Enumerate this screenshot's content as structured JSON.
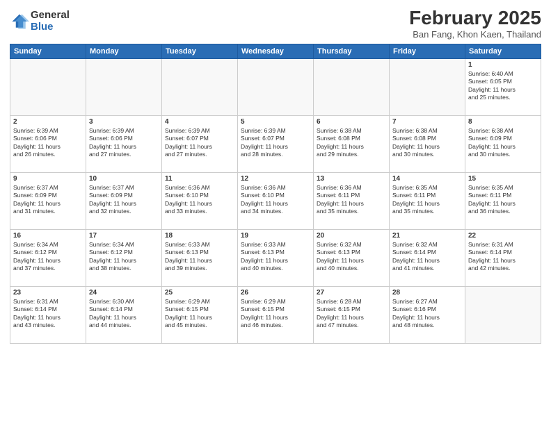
{
  "logo": {
    "general": "General",
    "blue": "Blue"
  },
  "title": "February 2025",
  "subtitle": "Ban Fang, Khon Kaen, Thailand",
  "weekdays": [
    "Sunday",
    "Monday",
    "Tuesday",
    "Wednesday",
    "Thursday",
    "Friday",
    "Saturday"
  ],
  "weeks": [
    [
      {
        "day": "",
        "info": ""
      },
      {
        "day": "",
        "info": ""
      },
      {
        "day": "",
        "info": ""
      },
      {
        "day": "",
        "info": ""
      },
      {
        "day": "",
        "info": ""
      },
      {
        "day": "",
        "info": ""
      },
      {
        "day": "1",
        "info": "Sunrise: 6:40 AM\nSunset: 6:05 PM\nDaylight: 11 hours\nand 25 minutes."
      }
    ],
    [
      {
        "day": "2",
        "info": "Sunrise: 6:39 AM\nSunset: 6:06 PM\nDaylight: 11 hours\nand 26 minutes."
      },
      {
        "day": "3",
        "info": "Sunrise: 6:39 AM\nSunset: 6:06 PM\nDaylight: 11 hours\nand 27 minutes."
      },
      {
        "day": "4",
        "info": "Sunrise: 6:39 AM\nSunset: 6:07 PM\nDaylight: 11 hours\nand 27 minutes."
      },
      {
        "day": "5",
        "info": "Sunrise: 6:39 AM\nSunset: 6:07 PM\nDaylight: 11 hours\nand 28 minutes."
      },
      {
        "day": "6",
        "info": "Sunrise: 6:38 AM\nSunset: 6:08 PM\nDaylight: 11 hours\nand 29 minutes."
      },
      {
        "day": "7",
        "info": "Sunrise: 6:38 AM\nSunset: 6:08 PM\nDaylight: 11 hours\nand 30 minutes."
      },
      {
        "day": "8",
        "info": "Sunrise: 6:38 AM\nSunset: 6:09 PM\nDaylight: 11 hours\nand 30 minutes."
      }
    ],
    [
      {
        "day": "9",
        "info": "Sunrise: 6:37 AM\nSunset: 6:09 PM\nDaylight: 11 hours\nand 31 minutes."
      },
      {
        "day": "10",
        "info": "Sunrise: 6:37 AM\nSunset: 6:09 PM\nDaylight: 11 hours\nand 32 minutes."
      },
      {
        "day": "11",
        "info": "Sunrise: 6:36 AM\nSunset: 6:10 PM\nDaylight: 11 hours\nand 33 minutes."
      },
      {
        "day": "12",
        "info": "Sunrise: 6:36 AM\nSunset: 6:10 PM\nDaylight: 11 hours\nand 34 minutes."
      },
      {
        "day": "13",
        "info": "Sunrise: 6:36 AM\nSunset: 6:11 PM\nDaylight: 11 hours\nand 35 minutes."
      },
      {
        "day": "14",
        "info": "Sunrise: 6:35 AM\nSunset: 6:11 PM\nDaylight: 11 hours\nand 35 minutes."
      },
      {
        "day": "15",
        "info": "Sunrise: 6:35 AM\nSunset: 6:11 PM\nDaylight: 11 hours\nand 36 minutes."
      }
    ],
    [
      {
        "day": "16",
        "info": "Sunrise: 6:34 AM\nSunset: 6:12 PM\nDaylight: 11 hours\nand 37 minutes."
      },
      {
        "day": "17",
        "info": "Sunrise: 6:34 AM\nSunset: 6:12 PM\nDaylight: 11 hours\nand 38 minutes."
      },
      {
        "day": "18",
        "info": "Sunrise: 6:33 AM\nSunset: 6:13 PM\nDaylight: 11 hours\nand 39 minutes."
      },
      {
        "day": "19",
        "info": "Sunrise: 6:33 AM\nSunset: 6:13 PM\nDaylight: 11 hours\nand 40 minutes."
      },
      {
        "day": "20",
        "info": "Sunrise: 6:32 AM\nSunset: 6:13 PM\nDaylight: 11 hours\nand 40 minutes."
      },
      {
        "day": "21",
        "info": "Sunrise: 6:32 AM\nSunset: 6:14 PM\nDaylight: 11 hours\nand 41 minutes."
      },
      {
        "day": "22",
        "info": "Sunrise: 6:31 AM\nSunset: 6:14 PM\nDaylight: 11 hours\nand 42 minutes."
      }
    ],
    [
      {
        "day": "23",
        "info": "Sunrise: 6:31 AM\nSunset: 6:14 PM\nDaylight: 11 hours\nand 43 minutes."
      },
      {
        "day": "24",
        "info": "Sunrise: 6:30 AM\nSunset: 6:14 PM\nDaylight: 11 hours\nand 44 minutes."
      },
      {
        "day": "25",
        "info": "Sunrise: 6:29 AM\nSunset: 6:15 PM\nDaylight: 11 hours\nand 45 minutes."
      },
      {
        "day": "26",
        "info": "Sunrise: 6:29 AM\nSunset: 6:15 PM\nDaylight: 11 hours\nand 46 minutes."
      },
      {
        "day": "27",
        "info": "Sunrise: 6:28 AM\nSunset: 6:15 PM\nDaylight: 11 hours\nand 47 minutes."
      },
      {
        "day": "28",
        "info": "Sunrise: 6:27 AM\nSunset: 6:16 PM\nDaylight: 11 hours\nand 48 minutes."
      },
      {
        "day": "",
        "info": ""
      }
    ]
  ]
}
